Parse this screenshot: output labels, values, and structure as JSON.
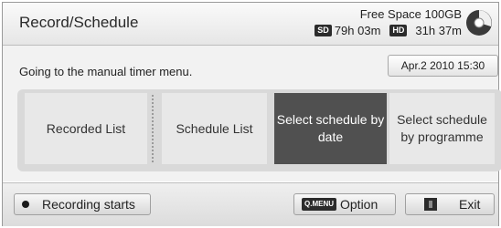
{
  "header": {
    "title": "Record/Schedule",
    "free_space": "Free Space 100GB",
    "sd_badge": "SD",
    "sd_time": "79h 03m",
    "hd_badge": "HD",
    "hd_time": "31h 37m"
  },
  "message": "Going to the manual timer menu.",
  "date": "Apr.2 2010 15:30",
  "menu": {
    "items": [
      {
        "label": "Recorded List",
        "active": false
      },
      {
        "label": "Schedule List",
        "active": false
      },
      {
        "label": "Select schedule by date",
        "active": true
      },
      {
        "label": "Select schedule by programme",
        "active": false
      }
    ]
  },
  "footer": {
    "recording_label": "Recording starts",
    "qmenu_badge": "Q.MENU",
    "option_label": "Option",
    "exit_label": "Exit"
  },
  "colors": {
    "active_button": "#505050",
    "menu_background": "#d9d9d9"
  }
}
